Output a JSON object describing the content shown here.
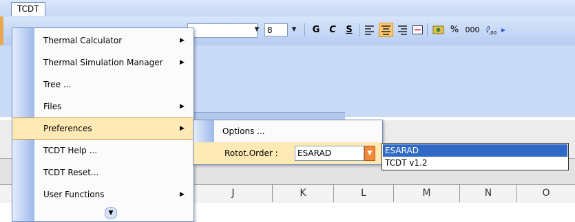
{
  "menubar": {
    "tcdt_label": "TCDT"
  },
  "toolbar": {
    "font_size": "8",
    "bold_label": "G",
    "italic_label": "C",
    "underline_label": "S",
    "percent_label": "%",
    "thousands_label": "000"
  },
  "main_menu": {
    "items": [
      {
        "label": "Thermal Calculator",
        "submenu": true
      },
      {
        "label": "Thermal Simulation Manager",
        "submenu": true
      },
      {
        "label": "Tree ...",
        "submenu": false
      },
      {
        "label": "Files",
        "submenu": true
      },
      {
        "label": "Preferences",
        "submenu": true,
        "highlighted": true
      },
      {
        "label": "TCDT Help ...",
        "submenu": false
      },
      {
        "label": "TCDT Reset...",
        "submenu": false
      },
      {
        "label": "User Functions",
        "submenu": true
      }
    ]
  },
  "preferences_submenu": {
    "options_label": "Options ...",
    "rotot_order_label": "Rotot.Order :",
    "rotot_order_value": "ESARAD"
  },
  "rotot_order_dropdown": {
    "options": [
      "ESARAD",
      "TCDT v1.2"
    ],
    "selected": "ESARAD"
  },
  "columns": [
    "J",
    "K",
    "L",
    "M",
    "N",
    "O"
  ],
  "colors": {
    "highlight": "#ffe9b5",
    "selection": "#316ac5",
    "accent_orange": "#f08a3a"
  }
}
